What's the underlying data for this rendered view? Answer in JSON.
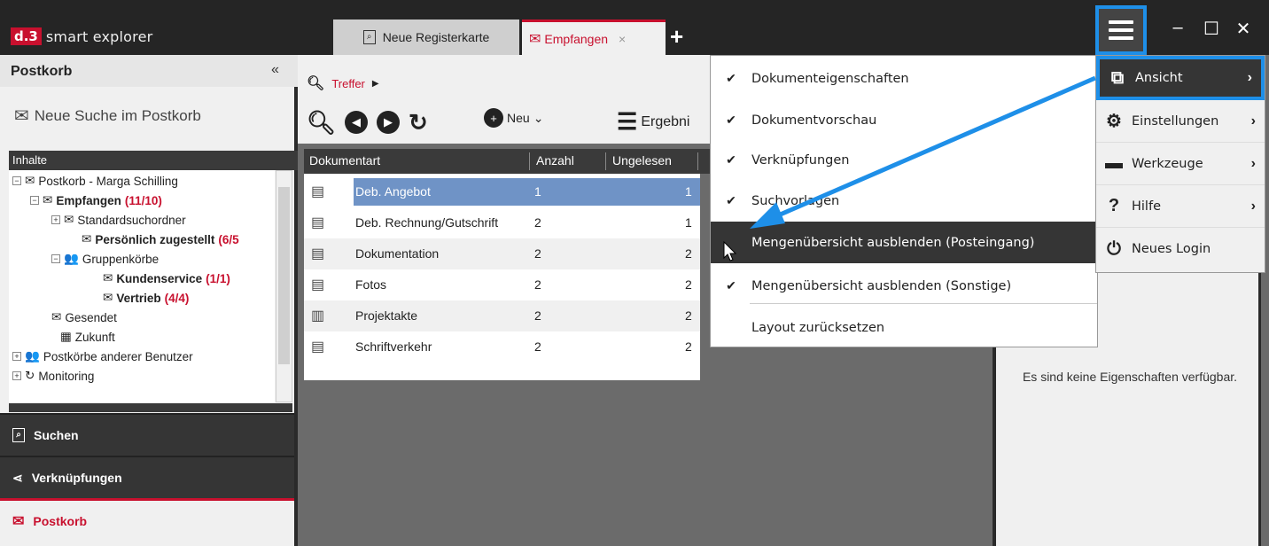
{
  "app": {
    "logo_prefix": "d.3",
    "logo_name": "smart explorer"
  },
  "tabs": [
    {
      "label": "Neue Registerkarte"
    },
    {
      "label": "Empfangen",
      "close": "×"
    }
  ],
  "window": {
    "add_tab": "+",
    "minimize": "–",
    "maximize": "☐",
    "close": "✕"
  },
  "left": {
    "title": "Postkorb",
    "collapse": "«",
    "new_search": "Neue Suche im Postkorb",
    "section": "Inhalte",
    "tree": {
      "root": "Postkorb - Marga Schilling",
      "empfangen": "Empfangen",
      "empfangen_count": "(11/10)",
      "standardsuch": "Standardsuchordner",
      "persoenlich": "Persönlich zugestellt",
      "persoenlich_count": "(6/5",
      "gruppenkoerbe": "Gruppenkörbe",
      "kundenservice": "Kundenservice",
      "kundenservice_count": "(1/1)",
      "vertrieb": "Vertrieb",
      "vertrieb_count": "(4/4)",
      "gesendet": "Gesendet",
      "zukunft": "Zukunft",
      "andere": "Postkörbe anderer Benutzer",
      "monitoring": "Monitoring"
    },
    "nav": [
      {
        "label": "Suchen"
      },
      {
        "label": "Verknüpfungen"
      },
      {
        "label": "Postkorb"
      }
    ]
  },
  "center": {
    "breadcrumb": "Treffer",
    "new_label": "Neu",
    "results_label": "Ergebni",
    "columns": [
      "Dokumentart",
      "Anzahl",
      "Ungelesen"
    ],
    "rows": [
      {
        "type": "Deb. Angebot",
        "count": "1",
        "unread": "1",
        "selected": true
      },
      {
        "type": "Deb. Rechnung/Gutschrift",
        "count": "2",
        "unread": "1"
      },
      {
        "type": "Dokumentation",
        "count": "2",
        "unread": "2"
      },
      {
        "type": "Fotos",
        "count": "2",
        "unread": "2"
      },
      {
        "type": "Projektakte",
        "count": "2",
        "unread": "2"
      },
      {
        "type": "Schriftverkehr",
        "count": "2",
        "unread": "2"
      }
    ]
  },
  "right": {
    "empty_message": "Es sind keine Eigenschaften verfügbar."
  },
  "view_submenu": [
    {
      "label": "Dokumenteigenschaften",
      "checked": true
    },
    {
      "label": "Dokumentvorschau",
      "checked": true
    },
    {
      "label": "Verknüpfungen",
      "checked": true
    },
    {
      "label": "Suchvorlagen",
      "checked": true
    },
    {
      "label": "Mengenübersicht ausblenden (Posteingang)",
      "checked": false,
      "hover": true
    },
    {
      "label": "Mengenübersicht ausblenden (Sonstige)",
      "checked": true
    },
    {
      "label": "Layout zurücksetzen",
      "checked": false
    }
  ],
  "main_menu": [
    {
      "label": "Ansicht",
      "icon": "window-layout-icon"
    },
    {
      "label": "Einstellungen",
      "icon": "tools-icon"
    },
    {
      "label": "Werkzeuge",
      "icon": "toolbox-icon"
    },
    {
      "label": "Hilfe",
      "icon": "question-icon"
    },
    {
      "label": "Neues Login",
      "icon": "plug-icon"
    }
  ],
  "colors": {
    "accent": "#c8102e",
    "highlight": "#1e8fe8",
    "selection": "#6f93c6",
    "dark": "#353535"
  }
}
